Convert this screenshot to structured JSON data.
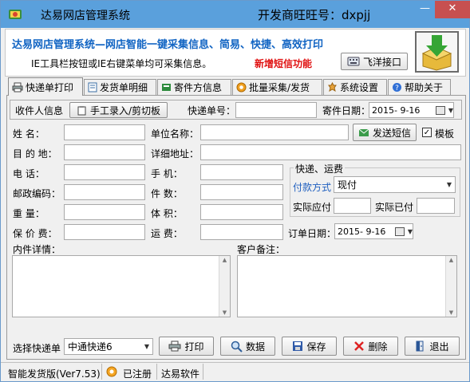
{
  "window": {
    "title": "达易网店管理系统",
    "title_right": "开发商旺旺号：dxpjj",
    "minimize_glyph": "—",
    "close_glyph": "✕"
  },
  "banner": {
    "title": "达易网店管理系统—网店智能一键采集信息、简易、快捷、高效打印",
    "note": "IE工具栏按钮或IE右键菜单均可采集信息。",
    "new_feature": "新增短信功能",
    "api_button": "飞洋接口",
    "logo_icon": "download-box-icon"
  },
  "tabs": [
    {
      "label": "快递单打印",
      "icon": "printer-icon",
      "active": true
    },
    {
      "label": "发货单明细",
      "icon": "document-icon"
    },
    {
      "label": "寄件方信息",
      "icon": "sender-icon"
    },
    {
      "label": "批量采集/发货",
      "icon": "batch-icon"
    },
    {
      "label": "系统设置",
      "icon": "settings-icon"
    },
    {
      "label": "帮助关于",
      "icon": "help-icon"
    }
  ],
  "recipient_bar": {
    "label": "收件人信息",
    "manual_button": "手工录入/剪切板",
    "tracking_label": "快递单号：",
    "tracking_value": "",
    "send_date_label": "寄件日期：",
    "send_date_value": "2015- 9-16"
  },
  "form": {
    "name_label": "姓    名：",
    "name_value": "",
    "company_label": "单位名称：",
    "company_value": "",
    "sms_button": "发送短信",
    "template_label": "模板",
    "template_checked": true,
    "destination_label": "目 的 地：",
    "destination_value": "",
    "address_label": "详细地址：",
    "address_value": "",
    "phone_label": "电    话：",
    "phone_value": "",
    "mobile_label": "手    机：",
    "mobile_value": "",
    "postcode_label": "邮政编码：",
    "postcode_value": "",
    "pieces_label": "件    数：",
    "pieces_value": "",
    "weight_label": "重    量：",
    "weight_value": "",
    "volume_label": "体    积：",
    "volume_value": "",
    "insured_label": "保 价 费：",
    "insured_value": "",
    "freight_label": "运    费：",
    "freight_value": "",
    "order_date_label": "订单日期：",
    "order_date_value": "2015- 9-16",
    "items_label": "内件详情：",
    "items_value": "",
    "customer_note_label": "客户备注：",
    "customer_note_value": ""
  },
  "shipping": {
    "legend": "快递、运费",
    "payment_label": "付款方式",
    "payment_value": "现付",
    "receivable_label": "实际应付",
    "receivable_value": "",
    "paid_label": "实际已付",
    "paid_value": ""
  },
  "actions": {
    "select_courier_label": "选择快递单",
    "courier_value": "中通快递6",
    "print": "打印",
    "data": "数据",
    "save": "保存",
    "delete": "删除",
    "exit": "退出"
  },
  "status": {
    "version": "智能发货版(Ver7.53)",
    "registered": "已注册",
    "company": "达易软件"
  },
  "colors": {
    "titlebar": "#5aa0dc",
    "close_button": "#c75050",
    "banner_title": "#1164c3",
    "new_feature": "#e01010",
    "payment_label": "#1f5fbf"
  }
}
